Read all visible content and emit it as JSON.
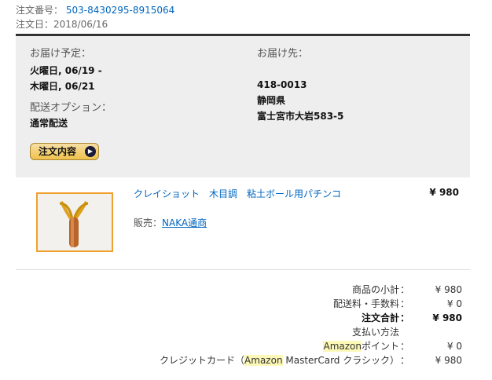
{
  "order": {
    "number_label": "注文番号：",
    "number": "503-8430295-8915064",
    "date_label": "注文日：",
    "date": "2018/06/16"
  },
  "shipping": {
    "delivery_label": "お届け予定：",
    "delivery_line1": "火曜日, 06/19 -",
    "delivery_line2": "木曜日, 06/21",
    "option_label": "配送オプション：",
    "option_value": "通常配送",
    "detail_button": "注文内容",
    "address_label": "お届け先：",
    "postal": "418-0013",
    "prefecture": "静岡県",
    "city": "富士宮市大岩583-5"
  },
  "item": {
    "title": "クレイショット　木目調　粘土ボール用パチンコ",
    "price": "¥ 980",
    "seller_label": "販売：",
    "seller_name": "NAKA通商",
    "image_icon": "slingshot-product-image"
  },
  "summary": {
    "subtotal_label": "商品の小計",
    "subtotal_value": "¥ 980",
    "shipping_label": "配送料・手数料",
    "shipping_value": "¥ 0",
    "total_label": "注文合計",
    "total_value": "¥ 980",
    "payment_heading": "支払い方法",
    "points_label_hl": "Amazon",
    "points_label_rest": "ポイント",
    "points_value": "¥ 0",
    "card_label_a": "クレジットカード（",
    "card_label_hl": "Amazon",
    "card_label_b": " MasterCard クラシック）",
    "card_value": "¥ 980",
    "colon": "："
  }
}
